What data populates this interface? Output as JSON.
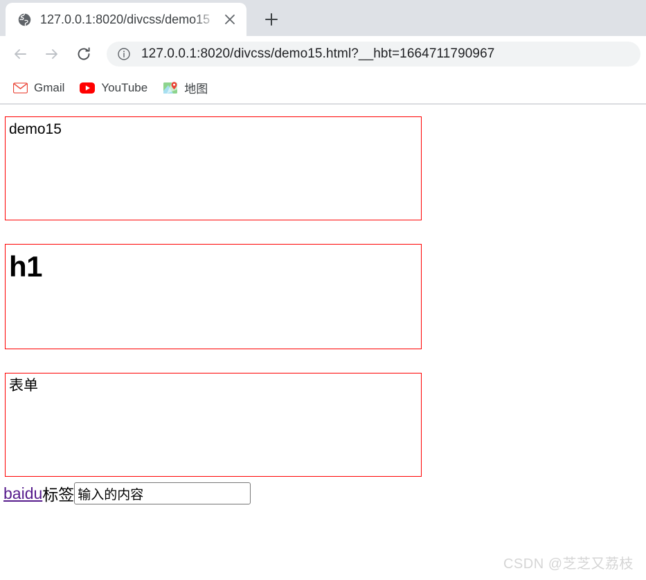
{
  "browser": {
    "tab": {
      "favicon": "globe-icon",
      "title": "127.0.0.1:8020/divcss/demo15",
      "close_label": "×"
    },
    "new_tab_label": "+",
    "nav": {
      "back": "back-arrow-icon",
      "forward": "forward-arrow-icon",
      "reload": "reload-icon"
    },
    "omnibox": {
      "security_icon": "info-circle-icon",
      "url": "127.0.0.1:8020/divcss/demo15.html?__hbt=1664711790967"
    },
    "bookmarks": [
      {
        "label": "Gmail",
        "icon": "gmail-icon"
      },
      {
        "label": "YouTube",
        "icon": "youtube-icon"
      },
      {
        "label": "地图",
        "icon": "google-maps-icon"
      }
    ]
  },
  "page": {
    "boxes": [
      {
        "text": "demo15"
      },
      {
        "text": "h1"
      },
      {
        "text": "表单"
      }
    ],
    "form": {
      "link_text": "baidu",
      "label_text": "标签",
      "input_value": "输入的内容",
      "input_placeholder": "输入的内容"
    },
    "box_border_color": "#ff0000",
    "link_color": "#551a8b"
  },
  "watermark": "CSDN @芝芝又荔枝"
}
